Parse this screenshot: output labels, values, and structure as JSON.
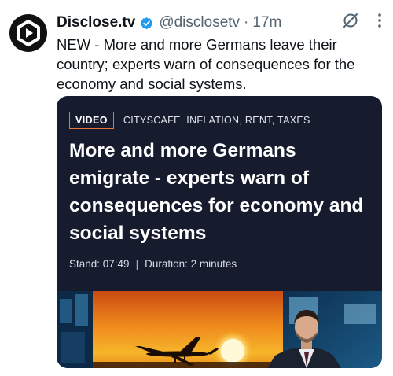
{
  "tweet": {
    "author_name": "Disclose.tv",
    "handle": "@disclosetv",
    "separator": "·",
    "time": "17m",
    "text": "NEW - More and more Germans leave their country; experts warn of consequences for the economy and social systems.",
    "icons": {
      "avatar": "disclose-tv-play-logo",
      "verified": "verified-badge-icon",
      "grok": "grok-icon",
      "more": "more-options-icon"
    },
    "colors": {
      "verified": "#1d9bf0",
      "text": "#0f1419",
      "secondary": "#536471"
    }
  },
  "card": {
    "badge": "VIDEO",
    "tags": "CITYSCAFE, INFLATION, RENT, TAXES",
    "headline": "More and more Germans emigrate - experts warn of consequences for economy and social systems",
    "stand": "Stand: 07:49",
    "meta_separator": "|",
    "duration": "Duration: 2 minutes",
    "colors": {
      "background": "#161b2e",
      "badge_border": "#e8773a"
    },
    "thumbnail": "airplane-sunset-and-news-anchor"
  }
}
